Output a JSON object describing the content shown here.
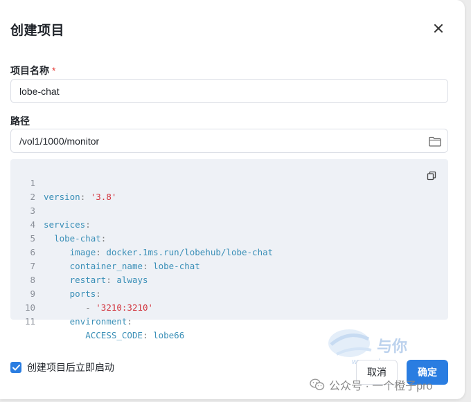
{
  "dialog": {
    "title": "创建项目",
    "close_icon": "close-icon"
  },
  "form": {
    "name_label": "项目名称",
    "required_mark": "*",
    "name_value": "lobe-chat",
    "path_label": "路径",
    "path_value": "/vol1/1000/monitor",
    "folder_icon": "folder-icon"
  },
  "code": {
    "copy_icon": "copy-icon",
    "lines": [
      {
        "n": "1"
      },
      {
        "n": "2"
      },
      {
        "n": "3"
      },
      {
        "n": "4"
      },
      {
        "n": "5"
      },
      {
        "n": "6"
      },
      {
        "n": "7"
      },
      {
        "n": "8"
      },
      {
        "n": "9"
      },
      {
        "n": "10"
      },
      {
        "n": "11"
      }
    ],
    "tokens": {
      "l1_key": "version",
      "l1_val": "'3.8'",
      "l3_key": "services",
      "l4_key": "lobe-chat",
      "l5_key": "image",
      "l5_val": "docker.1ms.run/lobehub/lobe-chat",
      "l6_key": "container_name",
      "l6_val": "lobe-chat",
      "l7_key": "restart",
      "l7_val": "always",
      "l8_key": "ports",
      "l9_dash": "-",
      "l9_val": "'3210:3210'",
      "l10_key": "environment",
      "l11_key": "ACCESS_CODE",
      "l11_val": "lobe66"
    }
  },
  "footer": {
    "autostart_label": "创建项目后立即启动",
    "autostart_checked": true,
    "cancel_label": "取消",
    "ok_label": "确定"
  },
  "watermark": {
    "logo_text": "与你",
    "url_text": "www.ynb",
    "wechat_text": "公众号 · 一个橙子pro"
  },
  "colors": {
    "accent": "#2a7de1",
    "code_bg": "#eef1f6",
    "key": "#3a8fb7",
    "string": "#d2343d",
    "required": "#e53935"
  }
}
